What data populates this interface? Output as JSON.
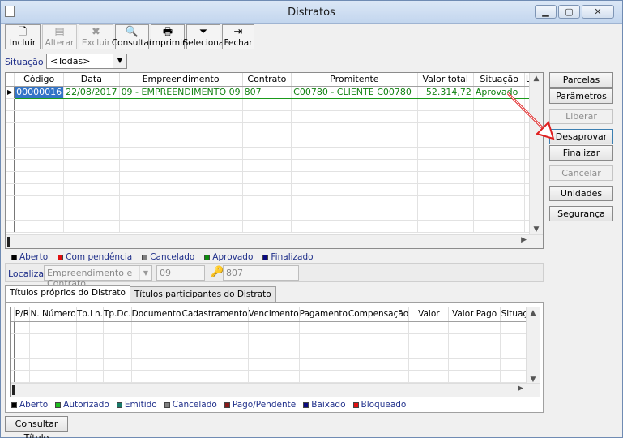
{
  "window": {
    "title": "Distratos"
  },
  "toolbar": [
    {
      "id": "incluir",
      "label": "Incluir",
      "icon": "new-doc-icon",
      "glyph": "🗋",
      "enabled": true,
      "width": 44
    },
    {
      "id": "alterar",
      "label": "Alterar",
      "icon": "edit-icon",
      "glyph": "▤",
      "enabled": false,
      "width": 43
    },
    {
      "id": "excluir",
      "label": "Excluir",
      "icon": "delete-icon",
      "glyph": "✖",
      "enabled": false,
      "width": 43
    },
    {
      "id": "consultar",
      "label": "Consultar",
      "icon": "magnifier-icon",
      "glyph": "🔍",
      "enabled": true,
      "width": 42
    },
    {
      "id": "imprimir",
      "label": "Imprimir",
      "icon": "printer-icon",
      "glyph": "🖶",
      "enabled": true,
      "width": 42
    },
    {
      "id": "selecionar",
      "label": "Seleciona",
      "icon": "filter-icon",
      "glyph": "⏷",
      "enabled": true,
      "width": 42
    },
    {
      "id": "fechar",
      "label": "Fechar",
      "icon": "exit-door-icon",
      "glyph": "⇥",
      "enabled": true,
      "width": 40
    }
  ],
  "filter": {
    "label": "Situação",
    "value": "<Todas>"
  },
  "main_grid": {
    "columns": [
      {
        "label": "Código",
        "width": 58
      },
      {
        "label": "Data",
        "width": 62
      },
      {
        "label": "Empreendimento",
        "width": 136
      },
      {
        "label": "Contrato",
        "width": 67
      },
      {
        "label": "Promitente",
        "width": 158
      },
      {
        "label": "Valor total",
        "width": 74
      },
      {
        "label": "Situação",
        "width": 67
      },
      {
        "label": "Lib.",
        "width": 22
      }
    ],
    "rows": [
      [
        "00000016",
        "22/08/2017",
        "09 - EMPREENDIMENTO 09",
        "807",
        "C00780 - CLIENTE C00780",
        "52.314,72",
        "Aprovado",
        ""
      ]
    ],
    "empty_rows": 11
  },
  "legend_main": [
    {
      "label": "Aberto",
      "color": "#000000"
    },
    {
      "label": "Com pendência",
      "color": "#e01010"
    },
    {
      "label": "Cancelado",
      "color": "#808080"
    },
    {
      "label": "Aprovado",
      "color": "#0f8a0f"
    },
    {
      "label": "Finalizado",
      "color": "#0a0a80"
    }
  ],
  "localizar": {
    "label": "Localizar",
    "field": "Empreendimento e Contrato",
    "value1": "09",
    "value2": "807"
  },
  "tabs": [
    {
      "label": "Títulos próprios do Distrato",
      "active": true
    },
    {
      "label": "Títulos participantes do Distrato",
      "active": false
    }
  ],
  "titles_grid": {
    "columns": [
      {
        "label": "P/R",
        "width": 20
      },
      {
        "label": "N. Número",
        "width": 57
      },
      {
        "label": "Tp.Ln.",
        "width": 28
      },
      {
        "label": "Tp.Dc.",
        "width": 30
      },
      {
        "label": "Documento",
        "width": 62
      },
      {
        "label": "Cadastramento",
        "width": 62
      },
      {
        "label": "Vencimento",
        "width": 60
      },
      {
        "label": "Pagamento",
        "width": 56
      },
      {
        "label": "Compensação",
        "width": 66
      },
      {
        "label": "Valor",
        "width": 70
      },
      {
        "label": "Valor Pago",
        "width": 70
      },
      {
        "label": "Situação",
        "width": 50
      }
    ],
    "empty_rows": 5
  },
  "legend_titles": [
    {
      "label": "Aberto",
      "color": "#000000"
    },
    {
      "label": "Autorizado",
      "color": "#1fbf1f"
    },
    {
      "label": "Emitido",
      "color": "#1a7a6a"
    },
    {
      "label": "Cancelado",
      "color": "#808080"
    },
    {
      "label": "Pago/Pendente",
      "color": "#8a1a1a"
    },
    {
      "label": "Baixado",
      "color": "#0a0a80"
    },
    {
      "label": "Bloqueado",
      "color": "#e01010"
    }
  ],
  "side_buttons": [
    {
      "id": "parcelas",
      "label": "Parcelas",
      "enabled": true
    },
    {
      "id": "parametros",
      "label": "Parâmetros",
      "enabled": true
    },
    {
      "id": "liberar",
      "label": "Liberar",
      "enabled": false
    },
    {
      "id": "desaprovar",
      "label": "Desaprovar",
      "enabled": true
    },
    {
      "id": "finalizar",
      "label": "Finalizar",
      "enabled": true
    },
    {
      "id": "cancelar",
      "label": "Cancelar",
      "enabled": false
    },
    {
      "id": "unidades",
      "label": "Unidades",
      "enabled": true
    },
    {
      "id": "seguranca",
      "label": "Segurança",
      "enabled": true
    }
  ],
  "bottom": {
    "consultar_titulo": "Consultar Título"
  },
  "colors": {
    "annotation_arrow": "#e02020",
    "selection": "#3374c7",
    "approved_text": "#118111"
  }
}
